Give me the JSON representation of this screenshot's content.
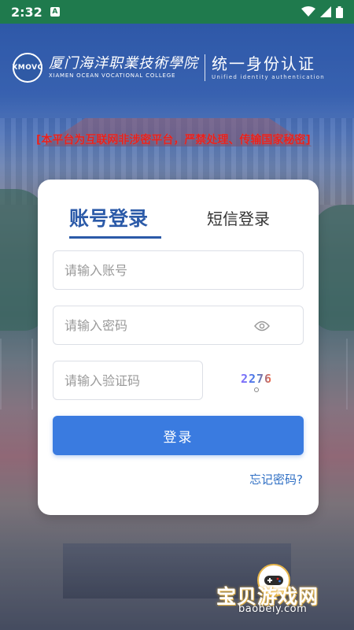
{
  "status_bar": {
    "time": "2:32",
    "notification_badge": "A",
    "icons": [
      "wifi-icon",
      "signal-icon",
      "battery-icon"
    ]
  },
  "header": {
    "seal_text": "XMOVC",
    "college_cn": "厦门海洋职業技術學院",
    "college_en": "XIAMEN OCEAN VOCATIONAL COLLEGE",
    "auth_title": "统一身份认证",
    "auth_subtitle": "Unified identity authentication"
  },
  "warning": "[本平台为互联网非涉密平台，严禁处理、传输国家秘密]",
  "login": {
    "tab_account": "账号登录",
    "tab_sms": "短信登录",
    "username_placeholder": "请输入账号",
    "password_placeholder": "请输入密码",
    "captcha_placeholder": "请输入验证码",
    "captcha_code": "2276",
    "login_button": "登录",
    "forgot_password": "忘记密码?"
  },
  "watermark": {
    "title": "宝贝游戏网",
    "url": "baobeiy.com"
  },
  "colors": {
    "primary": "#3a7be0",
    "tab_active": "#2b5aa8",
    "warning": "#e8211c",
    "status_bar": "#1f7a4d"
  }
}
